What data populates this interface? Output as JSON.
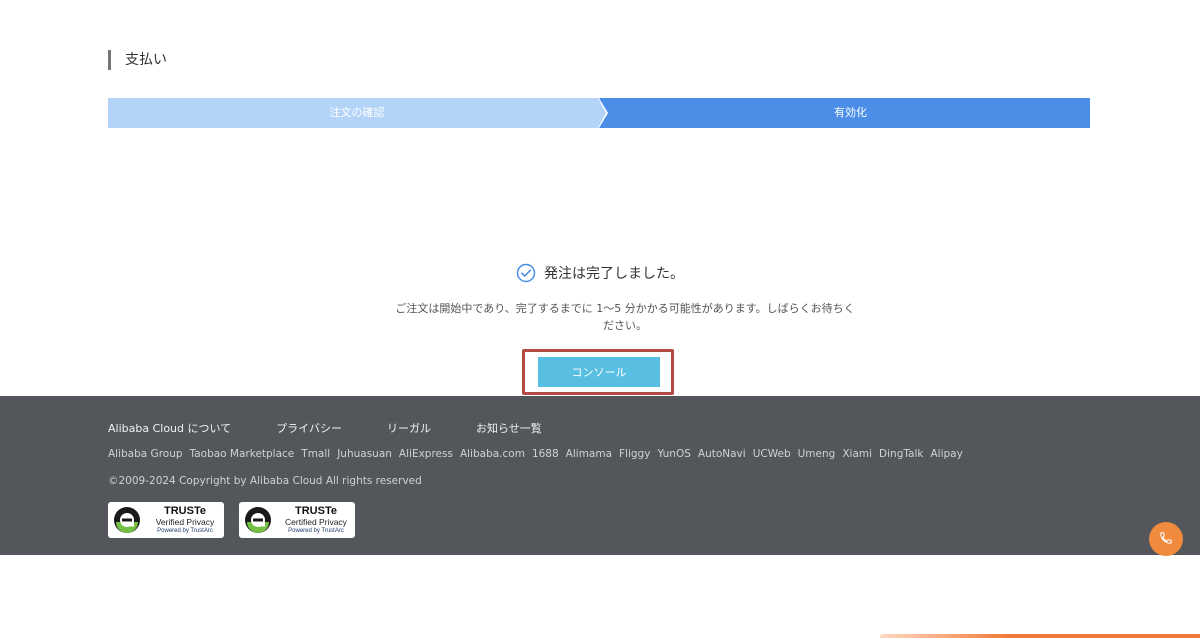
{
  "page": {
    "title": "支払い"
  },
  "steps": [
    {
      "label": "注文の確認",
      "state": "completed"
    },
    {
      "label": "有効化",
      "state": "active"
    }
  ],
  "result": {
    "title": "発注は完了しました。",
    "description": "ご注文は開始中であり、完了するまでに 1〜5 分かかる可能性があります。しばらくお待ちください。",
    "console_button": "コンソール",
    "icon": "check-circle-icon"
  },
  "footer": {
    "nav": [
      "Alibaba Cloud について",
      "プライバシー",
      "リーガル",
      "お知らせ一覧"
    ],
    "links": [
      "Alibaba Group",
      "Taobao Marketplace",
      "Tmall",
      "Juhuasuan",
      "AliExpress",
      "Alibaba.com",
      "1688",
      "Alimama",
      "Fliggy",
      "YunOS",
      "AutoNavi",
      "UCWeb",
      "Umeng",
      "Xiami",
      "DingTalk",
      "Alipay"
    ],
    "copyright": "©2009-2024 Copyright by Alibaba Cloud All rights reserved",
    "badges": [
      {
        "brand": "TRUSTe",
        "sub": "Verified Privacy",
        "powered": "Powered by TrustArc"
      },
      {
        "brand": "TRUSTe",
        "sub": "Certified Privacy",
        "powered": "Powered by TrustArc"
      }
    ]
  },
  "floating": {
    "icon": "phone-icon"
  },
  "colors": {
    "step_completed": "#b3d4f8",
    "step_active": "#4a8ee8",
    "console_button": "#59bfe2",
    "highlight_border": "#b34a46",
    "footer_bg": "#53565b",
    "phone_button": "#f08a3d"
  }
}
